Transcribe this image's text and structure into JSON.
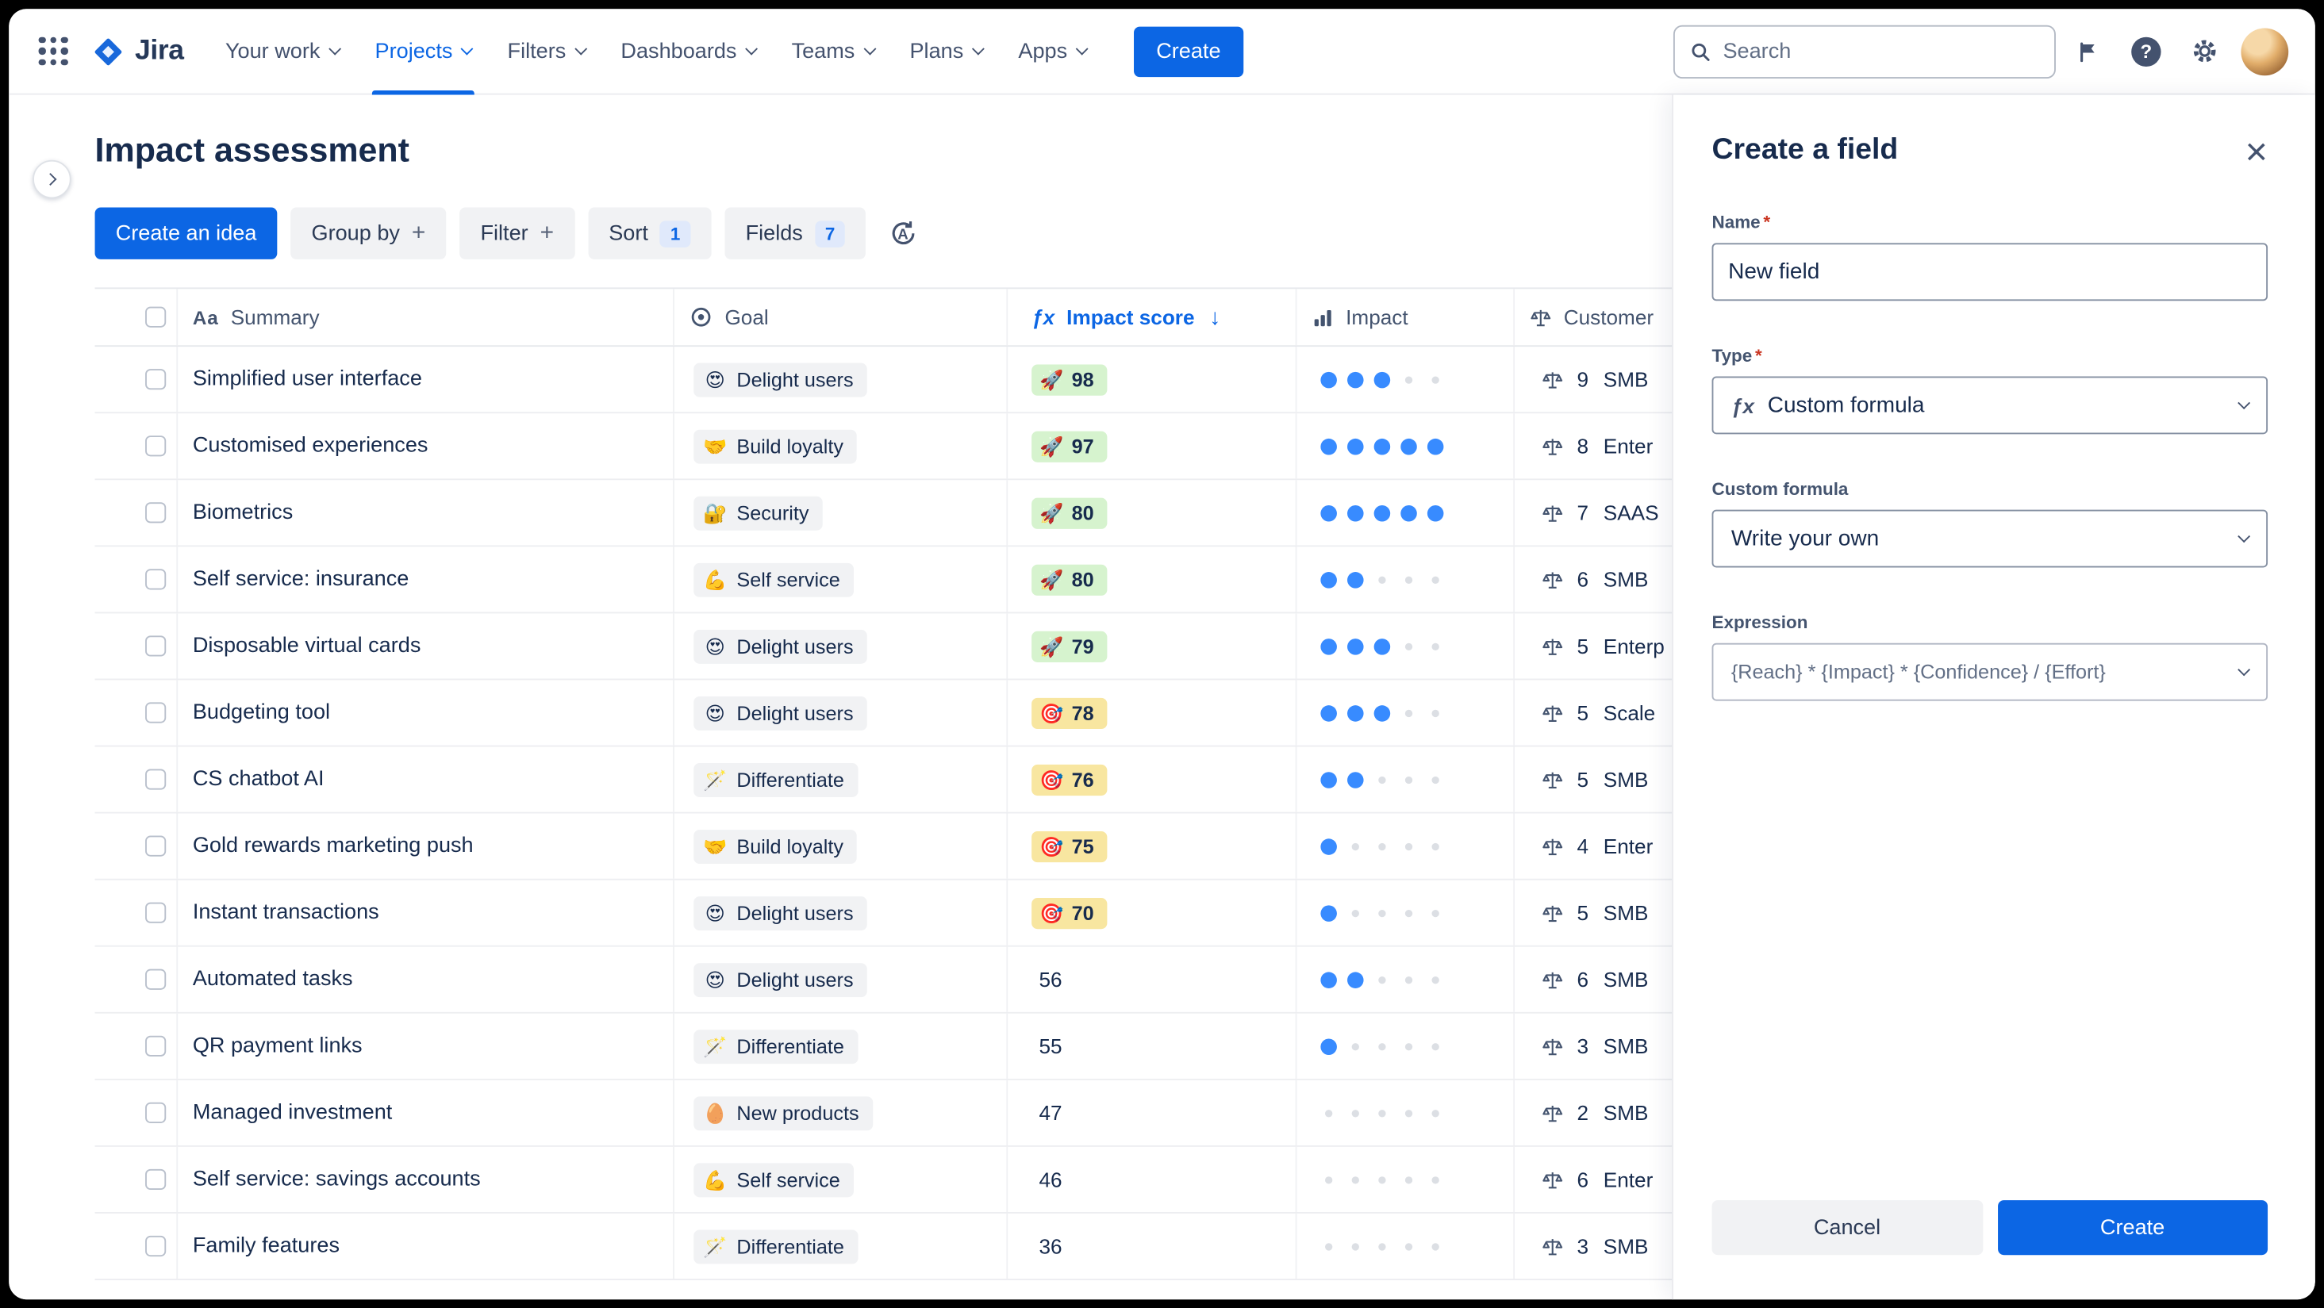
{
  "topnav": {
    "logo_text": "Jira",
    "items": [
      {
        "label": "Your work",
        "active": false
      },
      {
        "label": "Projects",
        "active": true
      },
      {
        "label": "Filters",
        "active": false
      },
      {
        "label": "Dashboards",
        "active": false
      },
      {
        "label": "Teams",
        "active": false
      },
      {
        "label": "Plans",
        "active": false
      },
      {
        "label": "Apps",
        "active": false
      }
    ],
    "create_label": "Create",
    "search_placeholder": "Search"
  },
  "icons": {
    "summary": "Aa",
    "fx": "ƒx",
    "sort_arrow": "↓"
  },
  "page": {
    "title": "Impact assessment",
    "toolbar": {
      "create_idea_label": "Create an idea",
      "group_by_label": "Group by",
      "filter_label": "Filter",
      "sort_label": "Sort",
      "sort_count": "1",
      "fields_label": "Fields",
      "fields_count": "7",
      "plus": "+"
    }
  },
  "table": {
    "headers": {
      "summary": "Summary",
      "goal": "Goal",
      "impact_score": "Impact score",
      "impact": "Impact",
      "customer": "Customer"
    },
    "rows": [
      {
        "summary": "Simplified user interface",
        "goal_emoji": "😍",
        "goal": "Delight users",
        "score": "98",
        "score_emoji": "🚀",
        "score_style": "green",
        "impact": 3,
        "customer_count": "9",
        "customer_segment": "SMB"
      },
      {
        "summary": "Customised experiences",
        "goal_emoji": "🤝",
        "goal": "Build loyalty",
        "score": "97",
        "score_emoji": "🚀",
        "score_style": "green",
        "impact": 5,
        "customer_count": "8",
        "customer_segment": "Enter"
      },
      {
        "summary": "Biometrics",
        "goal_emoji": "🔐",
        "goal": "Security",
        "score": "80",
        "score_emoji": "🚀",
        "score_style": "green",
        "impact": 5,
        "customer_count": "7",
        "customer_segment": "SAAS"
      },
      {
        "summary": "Self service: insurance",
        "goal_emoji": "💪",
        "goal": "Self service",
        "score": "80",
        "score_emoji": "🚀",
        "score_style": "green",
        "impact": 2,
        "customer_count": "6",
        "customer_segment": "SMB"
      },
      {
        "summary": "Disposable virtual cards",
        "goal_emoji": "😍",
        "goal": "Delight users",
        "score": "79",
        "score_emoji": "🚀",
        "score_style": "green",
        "impact": 3,
        "customer_count": "5",
        "customer_segment": "Enterp"
      },
      {
        "summary": "Budgeting tool",
        "goal_emoji": "😍",
        "goal": "Delight users",
        "score": "78",
        "score_emoji": "🎯",
        "score_style": "yellow",
        "impact": 3,
        "customer_count": "5",
        "customer_segment": "Scale"
      },
      {
        "summary": "CS chatbot AI",
        "goal_emoji": "🪄",
        "goal": "Differentiate",
        "score": "76",
        "score_emoji": "🎯",
        "score_style": "yellow",
        "impact": 2,
        "customer_count": "5",
        "customer_segment": "SMB"
      },
      {
        "summary": "Gold rewards marketing push",
        "goal_emoji": "🤝",
        "goal": "Build loyalty",
        "score": "75",
        "score_emoji": "🎯",
        "score_style": "yellow",
        "impact": 1,
        "customer_count": "4",
        "customer_segment": "Enter"
      },
      {
        "summary": "Instant transactions",
        "goal_emoji": "😍",
        "goal": "Delight users",
        "score": "70",
        "score_emoji": "🎯",
        "score_style": "yellow",
        "impact": 1,
        "customer_count": "5",
        "customer_segment": "SMB"
      },
      {
        "summary": "Automated tasks",
        "goal_emoji": "😍",
        "goal": "Delight users",
        "score": "56",
        "score_emoji": "",
        "score_style": "plain",
        "impact": 2,
        "customer_count": "6",
        "customer_segment": "SMB"
      },
      {
        "summary": "QR payment links",
        "goal_emoji": "🪄",
        "goal": "Differentiate",
        "score": "55",
        "score_emoji": "",
        "score_style": "plain",
        "impact": 1,
        "customer_count": "3",
        "customer_segment": "SMB"
      },
      {
        "summary": "Managed investment",
        "goal_emoji": "🥚",
        "goal": "New products",
        "score": "47",
        "score_emoji": "",
        "score_style": "plain",
        "impact": 0,
        "customer_count": "2",
        "customer_segment": "SMB"
      },
      {
        "summary": "Self service: savings accounts",
        "goal_emoji": "💪",
        "goal": "Self service",
        "score": "46",
        "score_emoji": "",
        "score_style": "plain",
        "impact": 0,
        "customer_count": "6",
        "customer_segment": "Enter"
      },
      {
        "summary": "Family features",
        "goal_emoji": "🪄",
        "goal": "Differentiate",
        "score": "36",
        "score_emoji": "",
        "score_style": "plain",
        "impact": 0,
        "customer_count": "3",
        "customer_segment": "SMB"
      }
    ]
  },
  "panel": {
    "title": "Create a field",
    "name": {
      "label": "Name",
      "required": "*",
      "value": "New field"
    },
    "type": {
      "label": "Type",
      "required": "*",
      "value": "Custom formula"
    },
    "custom_formula": {
      "label": "Custom formula",
      "value": "Write your own"
    },
    "expression": {
      "label": "Expression",
      "value": "{Reach} * {Impact} * {Confidence} / {Effort}"
    },
    "cancel_label": "Cancel",
    "create_label": "Create"
  },
  "colors": {
    "primary_blue": "#0C66E4",
    "score_green": "#D6F3CE",
    "score_yellow": "#F8E6A0",
    "impact_dot_blue": "#388BFF"
  }
}
